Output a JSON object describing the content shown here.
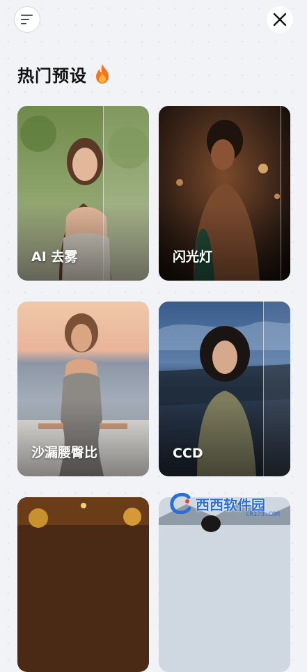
{
  "header": {
    "menu_icon": "menu-lines-icon",
    "close_icon": "close-icon"
  },
  "section": {
    "title": "热门预设",
    "title_icon": "fire-icon"
  },
  "presets": [
    {
      "label": "AI 去雾"
    },
    {
      "label": "闪光灯"
    },
    {
      "label": "沙漏腰臀比"
    },
    {
      "label": "CCD"
    },
    {
      "label": ""
    },
    {
      "label": ""
    }
  ],
  "watermark": {
    "text": "西西软件园",
    "sub": "CR173.COM"
  }
}
